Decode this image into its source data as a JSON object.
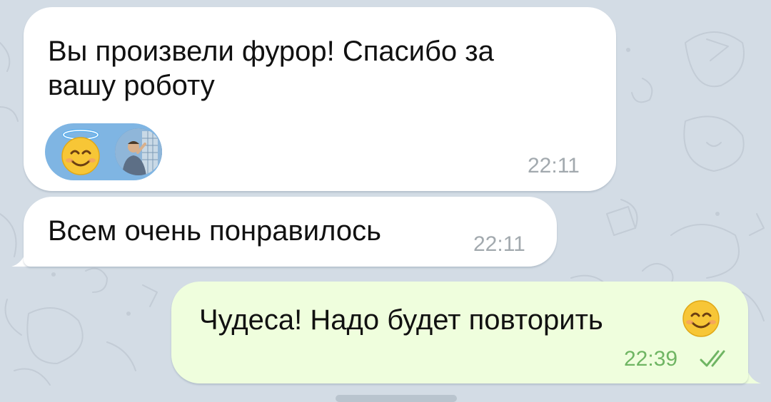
{
  "chat": {
    "messages": [
      {
        "direction": "incoming",
        "lines": [
          "Вы произвели фурор! Спасибо за",
          "вашу роботу"
        ],
        "time": "22:11",
        "reaction": {
          "emoji": "smiling-face-with-halo",
          "reacted_by": "user-avatar"
        }
      },
      {
        "direction": "incoming",
        "text": "Всем очень понравилось",
        "time": "22:11"
      },
      {
        "direction": "outgoing",
        "text": "Чудеса! Надо будет повторить",
        "trailing_emoji": "smiling-face-with-smiling-eyes",
        "time": "22:39",
        "status": "read"
      }
    ]
  },
  "colors": {
    "background": "#d3dce5",
    "incoming_bubble": "#ffffff",
    "outgoing_bubble": "#effedd",
    "incoming_time": "#a2a9ae",
    "outgoing_time": "#6fb563",
    "reaction_chip": "#7fb5e3"
  }
}
